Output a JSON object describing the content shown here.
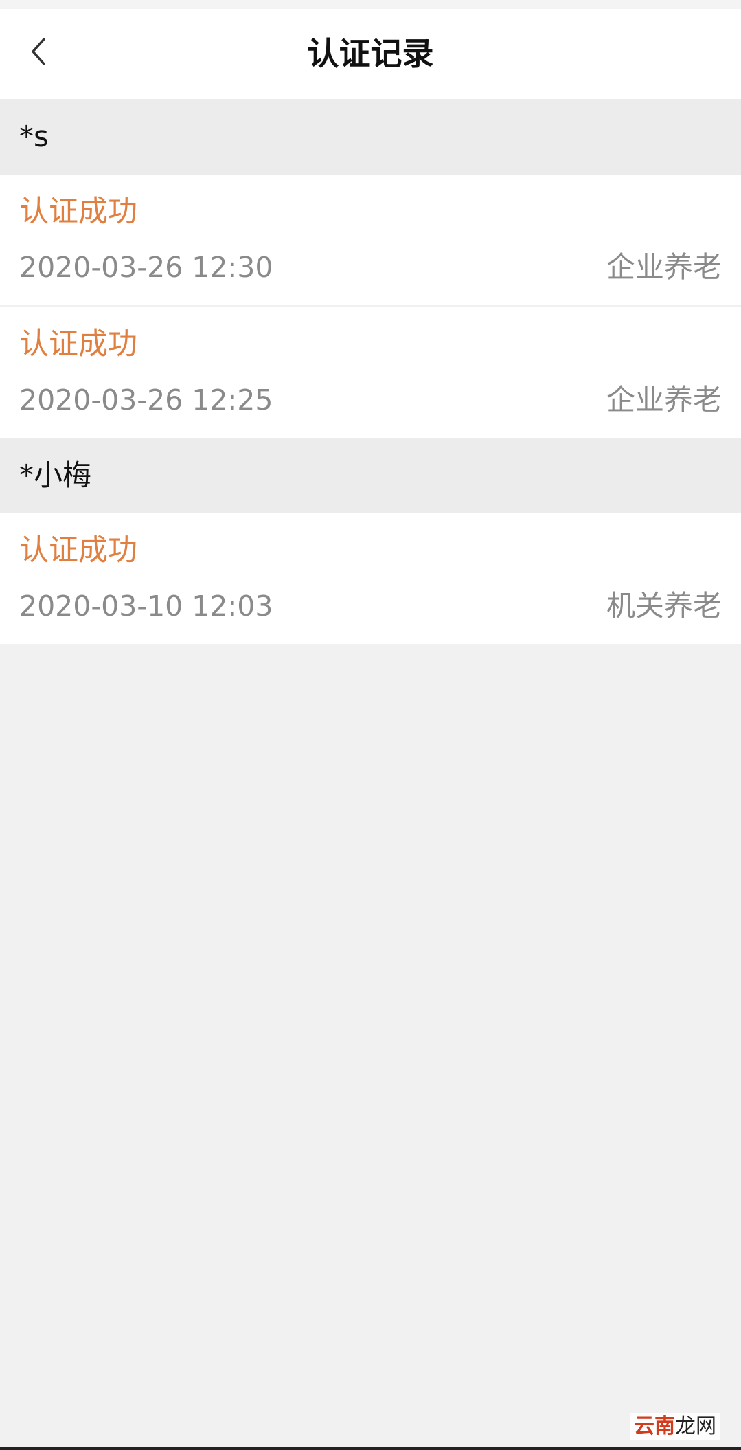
{
  "nav": {
    "title": "认证记录",
    "back_icon": "chevron-left-icon"
  },
  "groups": [
    {
      "name": "*s",
      "records": [
        {
          "status": "认证成功",
          "time": "2020-03-26 12:30",
          "type": "企业养老"
        },
        {
          "status": "认证成功",
          "time": "2020-03-26 12:25",
          "type": "企业养老"
        }
      ]
    },
    {
      "name": "*小梅",
      "records": [
        {
          "status": "认证成功",
          "time": "2020-03-10 12:03",
          "type": "机关养老"
        }
      ]
    }
  ],
  "watermark": {
    "part1": "云南",
    "part2": "龙网"
  },
  "colors": {
    "accent": "#e07f3f",
    "muted_text": "#8a8a8a",
    "group_bg": "#ececec",
    "page_bg": "#f1f1f1"
  }
}
